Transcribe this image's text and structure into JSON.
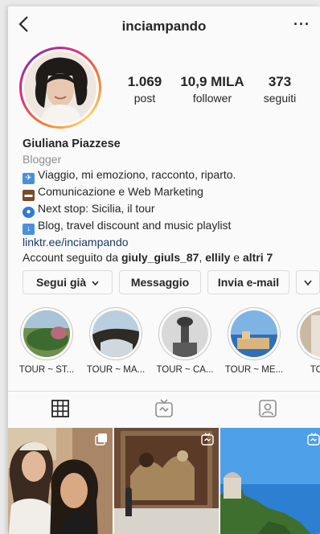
{
  "header": {
    "username": "inciampando",
    "back_glyph": "<",
    "more_glyph": "···"
  },
  "stats": [
    {
      "value": "1.069",
      "label": "post"
    },
    {
      "value": "10,9 MILA",
      "label": "follower"
    },
    {
      "value": "373",
      "label": "seguiti"
    }
  ],
  "bio": {
    "name": "Giuliana Piazzese",
    "category": "Blogger",
    "lines": [
      {
        "icon": "airplane-icon",
        "text": "Viaggio, mi emoziono, racconto, riparto."
      },
      {
        "icon": "briefcase-icon",
        "text": "Comunicazione e Web Marketing"
      },
      {
        "icon": "globe-icon",
        "text": "Next stop: Sicilia, il tour"
      },
      {
        "icon": "down-arrow-icon",
        "text": "Blog, travel discount and music playlist"
      }
    ],
    "link": "linktr.ee/inciampando",
    "followed_prefix": "Account seguito da ",
    "followed_user1": "giuly_giuls_87",
    "followed_sep": ", ",
    "followed_user2": "ellily",
    "followed_and": " e ",
    "followed_others": "altri 7"
  },
  "buttons": {
    "following": "Segui già",
    "message": "Messaggio",
    "email": "Invia e-mail"
  },
  "highlights": [
    {
      "label": "TOUR ~ ST..."
    },
    {
      "label": "TOUR ~ MA..."
    },
    {
      "label": "TOUR ~ CA..."
    },
    {
      "label": "TOUR ~ ME..."
    },
    {
      "label": "TOUR"
    }
  ],
  "tabs": [
    {
      "icon": "grid-icon",
      "active": true
    },
    {
      "icon": "igtv-icon",
      "active": false
    },
    {
      "icon": "tagged-icon",
      "active": false
    }
  ],
  "posts": [
    {
      "badge": "multiple-icon"
    },
    {
      "badge": "igtv-icon"
    },
    {
      "badge": "igtv-icon"
    }
  ]
}
